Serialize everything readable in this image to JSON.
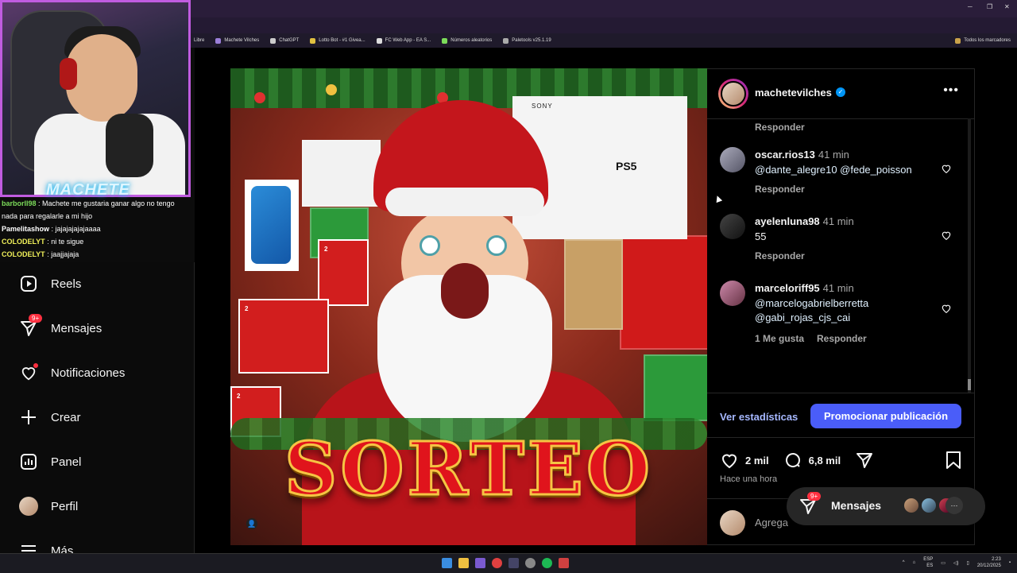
{
  "browser": {
    "bookmarks": [
      "Libre",
      "Machete Vilches",
      "ChatGPT",
      "Lotto Bot - #1 Givea...",
      "FC Web App - EA S...",
      "Números aleatorios",
      "Paletools v25.1.19"
    ],
    "bookmarks_right": "Todos los marcadores"
  },
  "stream": {
    "logo": "MACHETE",
    "chat": [
      {
        "user": "barborll98",
        "text": "Machete me gustaria ganar algo no tengo nada para regalarle a mi hijo"
      },
      {
        "user": "Pamelitashow",
        "text": "jajajajajajaaaa"
      },
      {
        "user": "COLODELYT",
        "text": "ni te sigue"
      },
      {
        "user": "COLODELYT",
        "text": "jaajjajaja"
      }
    ]
  },
  "sidebar": {
    "items": [
      {
        "label": "Reels",
        "icon": "reels-icon"
      },
      {
        "label": "Mensajes",
        "icon": "messages-icon",
        "badge": "9+"
      },
      {
        "label": "Notificaciones",
        "icon": "heart-icon"
      },
      {
        "label": "Crear",
        "icon": "plus-icon"
      },
      {
        "label": "Panel",
        "icon": "dashboard-icon"
      },
      {
        "label": "Perfil",
        "icon": "avatar"
      },
      {
        "label": "Más",
        "icon": "menu-icon"
      }
    ]
  },
  "post": {
    "image_text": {
      "title": "SORTEO",
      "ps5": "PS5",
      "sony": "SONY",
      "switch": "2"
    },
    "author": "machetevilches",
    "top_reply": "Responder",
    "comments": [
      {
        "user": "oscar.rios13",
        "time": "41 min",
        "text": "@dante_alegre10 @fede_poisson",
        "meta": [
          "Responder"
        ]
      },
      {
        "user": "ayelenluna98",
        "time": "41 min",
        "text": "55",
        "meta": [
          "Responder"
        ]
      },
      {
        "user": "marceloriff95",
        "time": "41 min",
        "text": "@marcelogabrielberretta\n@gabi_rojas_cjs_cai",
        "meta": [
          "1 Me gusta",
          "Responder"
        ]
      }
    ],
    "stats_link": "Ver estadísticas",
    "promote_button": "Promocionar publicación",
    "likes": "2 mil",
    "comment_count": "6,8 mil",
    "time_ago": "Hace una hora",
    "add_comment_placeholder": "Agrega"
  },
  "messages_pill": {
    "label": "Mensajes",
    "badge": "9+"
  },
  "taskbar": {
    "lang": "ESP",
    "lang_sub": "ES",
    "time": "2:23",
    "date": "20/12/2025"
  },
  "colors": {
    "accent": "#4a5df9",
    "badge": "#ff3040",
    "verified": "#0095f6",
    "link": "#e0f1ff"
  }
}
